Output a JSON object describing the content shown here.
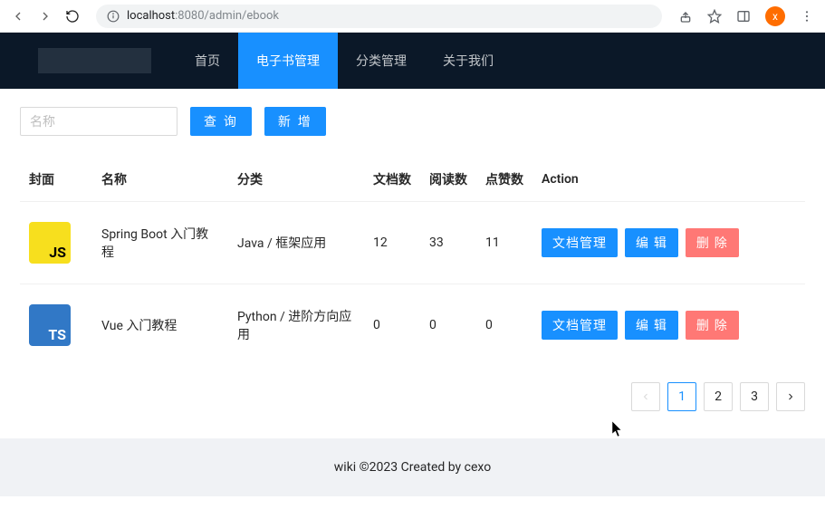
{
  "browser": {
    "url_host": "localhost",
    "url_port": ":8080",
    "url_path": "/admin/ebook",
    "avatar_letter": "x"
  },
  "nav": {
    "items": [
      {
        "label": "首页",
        "active": false
      },
      {
        "label": "电子书管理",
        "active": true
      },
      {
        "label": "分类管理",
        "active": false
      },
      {
        "label": "关于我们",
        "active": false
      }
    ]
  },
  "filters": {
    "name_placeholder": "名称",
    "search_label": "查 询",
    "add_label": "新 增"
  },
  "table": {
    "headers": {
      "cover": "封面",
      "name": "名称",
      "category": "分类",
      "docs": "文档数",
      "reads": "阅读数",
      "likes": "点赞数",
      "action": "Action"
    },
    "rows": [
      {
        "cover_type": "js",
        "cover_text": "JS",
        "name": "Spring Boot 入门教程",
        "category": "Java / 框架应用",
        "docs": "12",
        "reads": "33",
        "likes": "11"
      },
      {
        "cover_type": "ts",
        "cover_text": "TS",
        "name": "Vue 入门教程",
        "category": "Python / 进阶方向应用",
        "docs": "0",
        "reads": "0",
        "likes": "0"
      }
    ],
    "actions": {
      "doc_manage": "文档管理",
      "edit": "编 辑",
      "delete": "删 除"
    }
  },
  "pagination": {
    "pages": [
      "1",
      "2",
      "3"
    ],
    "current": "1"
  },
  "footer": {
    "text": "wiki ©2023 Created by cexo"
  }
}
